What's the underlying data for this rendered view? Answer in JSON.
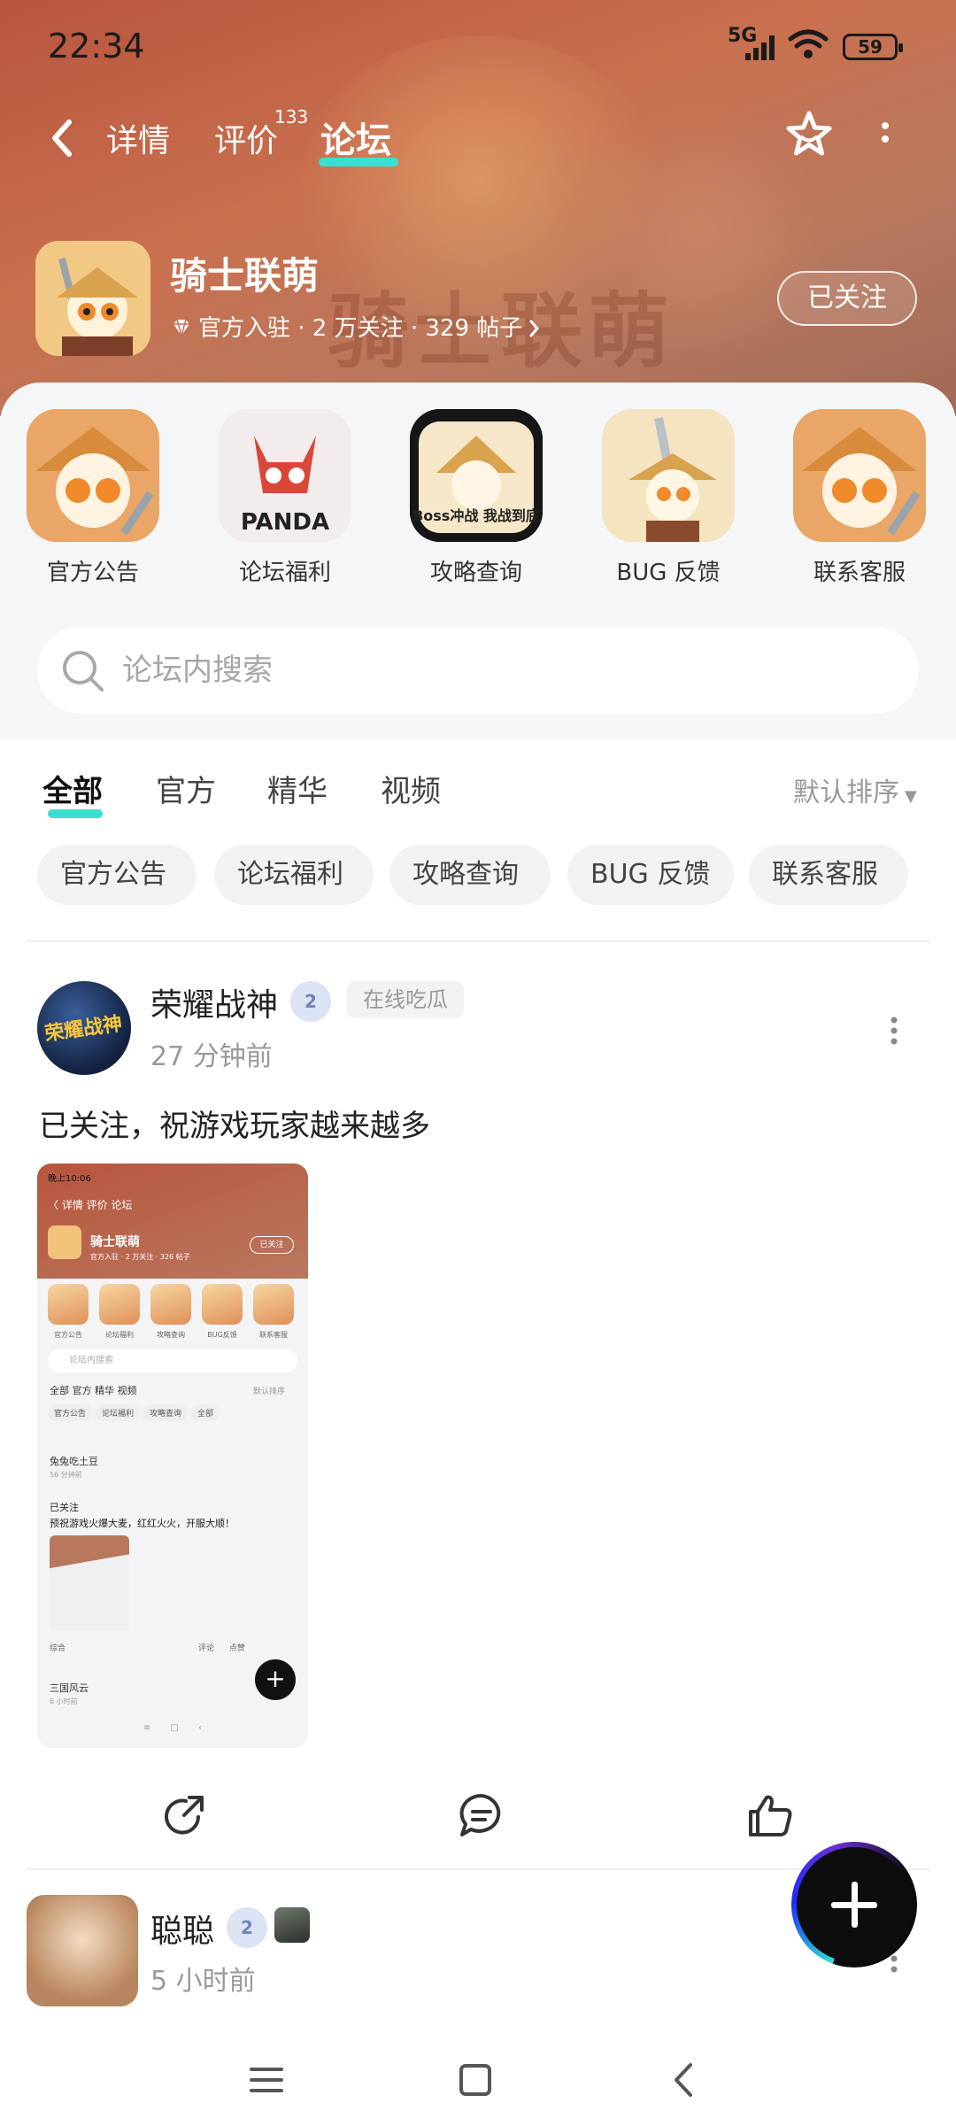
{
  "status": {
    "time": "22:34",
    "network": "5G",
    "battery": "59"
  },
  "nav": {
    "tabs": [
      "详情",
      "评价",
      "论坛"
    ],
    "review_count": "133"
  },
  "forum": {
    "name": "骑士联萌",
    "meta": "官方入驻 · 2 万关注 · 329 帖子",
    "follow_label": "已关注",
    "banner_watermark": "骑士联萌"
  },
  "categories": [
    {
      "label": "官方公告",
      "art": "PANDA"
    },
    {
      "label": "论坛福利",
      "art": "PANDA"
    },
    {
      "label": "攻略查询",
      "art": "Boss冲战 我战到底"
    },
    {
      "label": "BUG 反馈",
      "art": ""
    },
    {
      "label": "联系客服",
      "art": ""
    }
  ],
  "search": {
    "placeholder": "论坛内搜索"
  },
  "feed_tabs": {
    "items": [
      "全部",
      "官方",
      "精华",
      "视频"
    ],
    "sort": "默认排序"
  },
  "chips": [
    "官方公告",
    "论坛福利",
    "攻略查询",
    "BUG 反馈",
    "联系客服"
  ],
  "post1": {
    "user": "荣耀战神",
    "avatar_text": "荣耀战神",
    "level": "2",
    "tag": "在线吃瓜",
    "time": "27 分钟前",
    "text": "已关注，祝游戏玩家越来越多",
    "screenshot": {
      "time": "晚上10:06",
      "nav": "〈  详情   评价   论坛",
      "name": "骑士联萌",
      "follow": "已关注",
      "meta": "官方入驻 · 2 万关注 · 326 帖子",
      "cats": [
        "官方公告",
        "论坛福利",
        "攻略查询",
        "BUG反馈",
        "联系客服"
      ],
      "search": "论坛内搜索",
      "tabs": "全部     官方     精华     视频",
      "sort": "默认排序",
      "chips": [
        "官方公告",
        "论坛福利",
        "攻略查询",
        "全部"
      ],
      "user": "兔兔吃土豆",
      "user_time": "56 分钟前",
      "line1": "已关注",
      "line2": "预祝游戏火爆大麦，红红火火，开服大顺！",
      "footer_left": "综合",
      "footer_comment": "评论",
      "footer_like": "点赞",
      "user2": "三国风云",
      "user2_time": "6 小时前"
    }
  },
  "post2": {
    "user": "聪聪",
    "level": "2",
    "time": "5 小时前"
  }
}
